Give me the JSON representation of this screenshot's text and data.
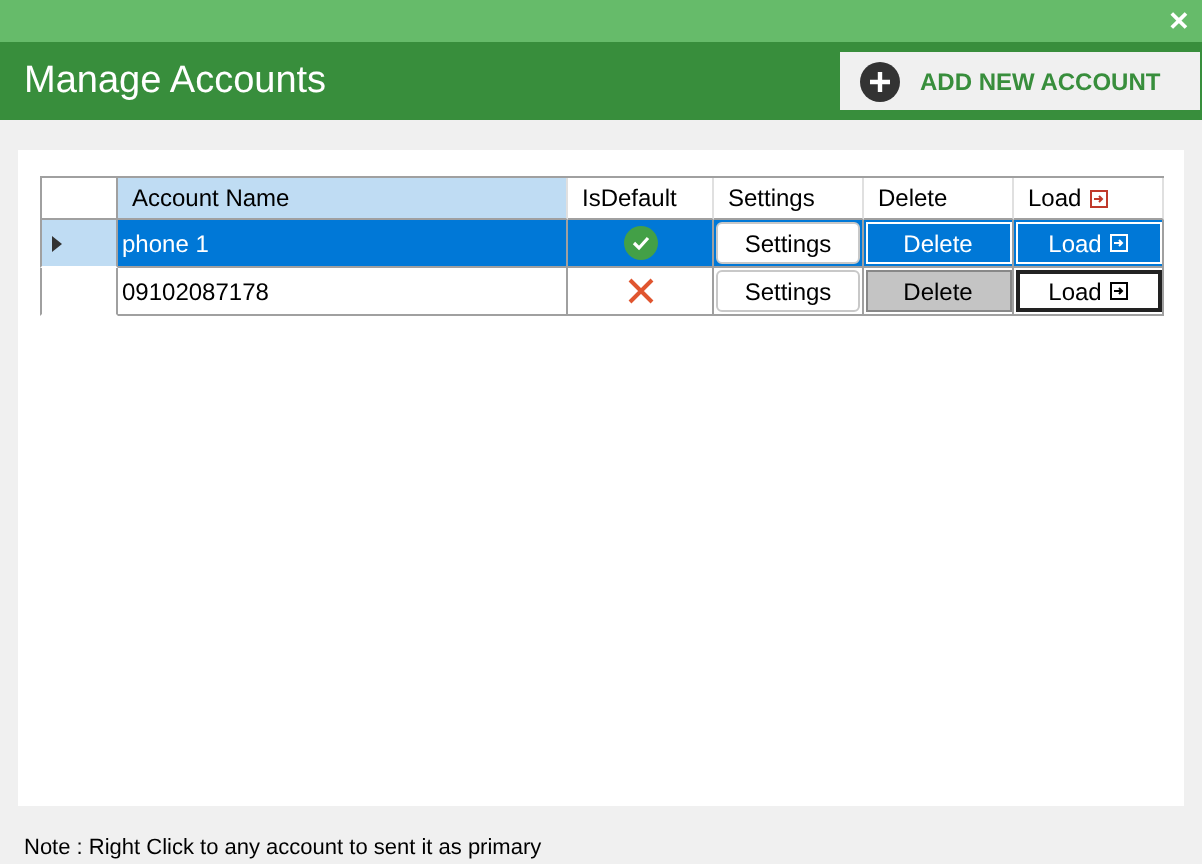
{
  "window": {
    "close": "✕"
  },
  "header": {
    "title": "Manage Accounts",
    "add_button": "ADD NEW ACCOUNT"
  },
  "table": {
    "columns": [
      "Account Name",
      "IsDefault",
      "Settings",
      "Delete",
      "Load"
    ],
    "rows": [
      {
        "name": "phone 1",
        "is_default": true,
        "selected": true,
        "settings": "Settings",
        "delete": "Delete",
        "load": "Load"
      },
      {
        "name": "09102087178",
        "is_default": false,
        "selected": false,
        "settings": "Settings",
        "delete": "Delete",
        "load": "Load"
      }
    ]
  },
  "note": "Note : Right Click to any account to sent it as primary"
}
